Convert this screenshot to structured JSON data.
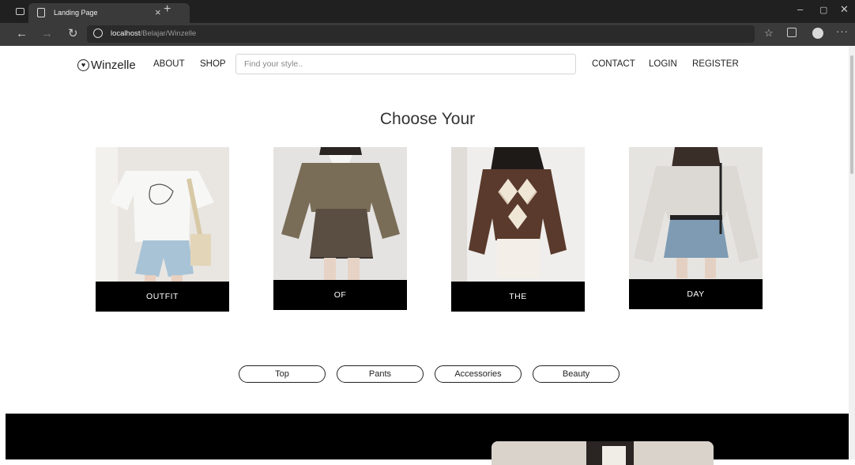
{
  "browser": {
    "tab_title": "Landing Page",
    "tab_close": "×",
    "new_tab": "+",
    "url_host": "localhost",
    "url_path": "/Belajar/Winzelle",
    "window_controls": {
      "minimize": "–",
      "maximize": "▢",
      "close": "✕"
    },
    "icons": [
      "window-icon",
      "page-icon",
      "back-icon",
      "forward-icon",
      "reload-icon",
      "globe-icon",
      "favorites-icon",
      "collections-icon",
      "profile-icon",
      "more-icon"
    ]
  },
  "site": {
    "logo": "Winzelle",
    "nav_left": [
      "ABOUT",
      "SHOP"
    ],
    "search_placeholder": "Find your style..",
    "nav_right": [
      "CONTACT",
      "LOGIN",
      "REGISTER"
    ]
  },
  "hero": {
    "heading": "Choose Your",
    "cards": [
      {
        "label": "OUTFIT"
      },
      {
        "label": "OF"
      },
      {
        "label": "THE"
      },
      {
        "label": "DAY"
      }
    ]
  },
  "categories": [
    "Top",
    "Pants",
    "Accessories",
    "Beauty"
  ],
  "colors": {
    "chrome_dark": "#202020",
    "chrome_bar": "#3a3a3a",
    "label_bg": "#000000",
    "page_bg": "#ffffff"
  }
}
